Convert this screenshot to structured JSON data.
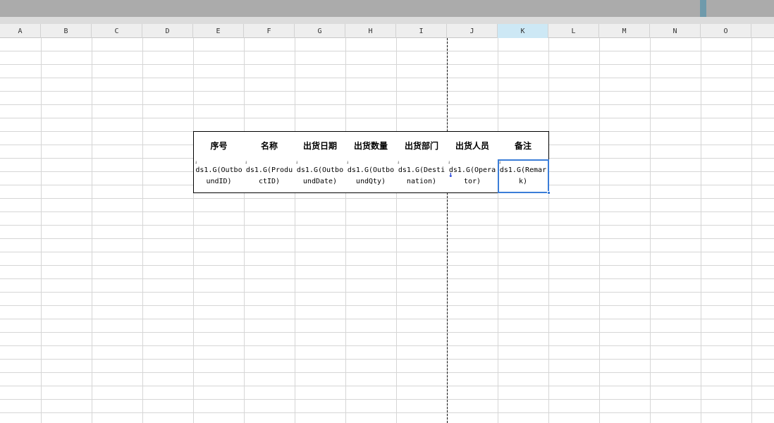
{
  "columns": [
    "A",
    "B",
    "C",
    "D",
    "E",
    "F",
    "G",
    "H",
    "I",
    "J",
    "K",
    "L",
    "M",
    "N",
    "O"
  ],
  "active_column": "K",
  "report_table": {
    "headers": [
      "序号",
      "名称",
      "出货日期",
      "出货数量",
      "出货部门",
      "出货人员",
      "备注"
    ],
    "row": [
      "ds1.G(OutboundID)",
      "ds1.G(ProductID)",
      "ds1.G(OutboundDate)",
      "ds1.G(OutboundQty)",
      "ds1.G(Destination)",
      "ds1.G(Operator)",
      "ds1.G(Remark)"
    ]
  },
  "colors": {
    "selection": "#3b7dd8",
    "active_header": "#cde8f5",
    "expand_arrow": "#1a39d8"
  },
  "icons": {
    "expand_mark": "expand-down-mark",
    "expand_arrow": "blue-down-arrow"
  }
}
